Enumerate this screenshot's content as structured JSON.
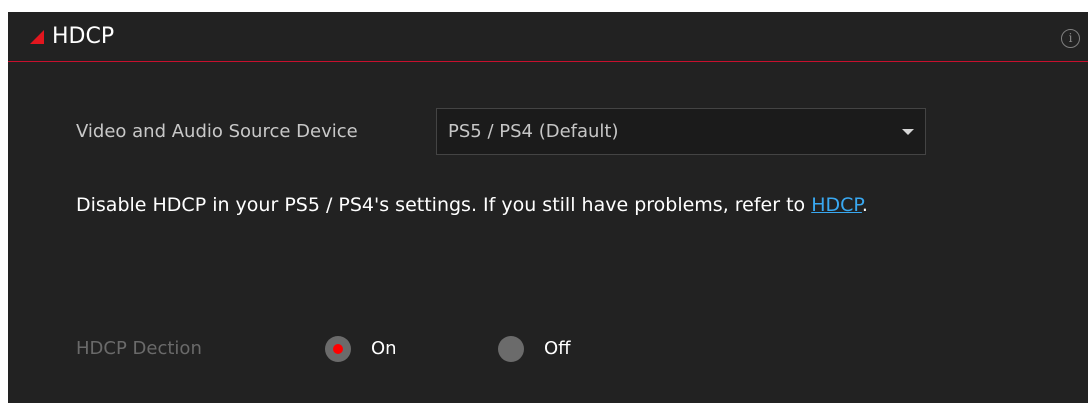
{
  "header": {
    "title": "HDCP",
    "info_icon": "info-circle-icon"
  },
  "source_device": {
    "label": "Video and Audio Source Device",
    "selected": "PS5 / PS4 (Default)"
  },
  "notice": {
    "text_before": "Disable HDCP in your PS5 / PS4's settings. If you still have problems, refer to ",
    "link": "HDCP",
    "text_after": "."
  },
  "detection": {
    "label": "HDCP Dection",
    "options": [
      {
        "label": "On",
        "selected": true
      },
      {
        "label": "Off",
        "selected": false
      }
    ]
  },
  "colors": {
    "accent": "#e3161e",
    "link": "#39a8f1",
    "background": "#222222"
  }
}
